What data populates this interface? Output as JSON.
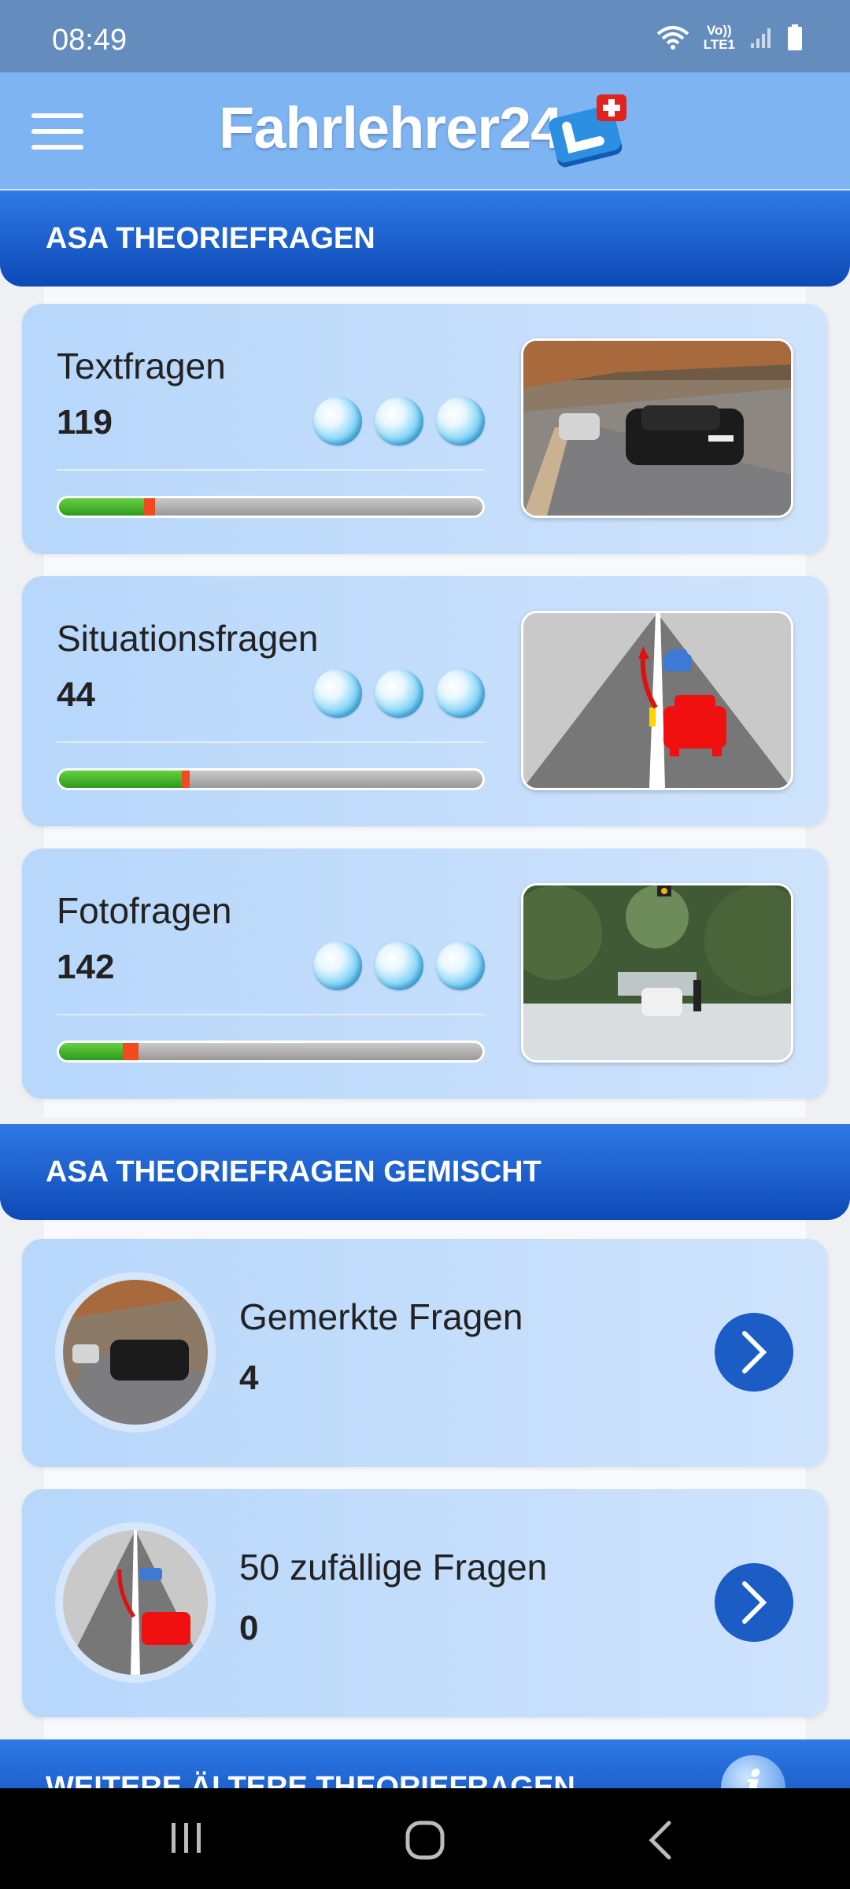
{
  "status": {
    "time": "08:49",
    "net_top": "Vo))",
    "net_bottom": "LTE1"
  },
  "app": {
    "title": "Fahrlehrer24"
  },
  "sections": [
    {
      "title": "ASA THEORIEFRAGEN"
    },
    {
      "title": "ASA THEORIEFRAGEN GEMISCHT"
    },
    {
      "title": "WEITERE ÄLTERE THEORIEFRAGEN"
    }
  ],
  "categories": [
    {
      "name": "Textfragen",
      "count": "119",
      "progress_green": 0.2,
      "progress_red": 0.03
    },
    {
      "name": "Situationsfragen",
      "count": "44",
      "progress_green": 0.29,
      "progress_red": 0.02
    },
    {
      "name": "Fotofragen",
      "count": "142",
      "progress_green": 0.15,
      "progress_red": 0.04
    }
  ],
  "mixed": [
    {
      "name": "Gemerkte Fragen",
      "count": "4"
    },
    {
      "name": "50 zufällige Fragen",
      "count": "0"
    }
  ],
  "colors": {
    "header": "#7fb4f3",
    "section": "#1a5bd0",
    "card": "#c4ddfb",
    "progress_green": "#3fb22a",
    "progress_red": "#f04a1e"
  }
}
